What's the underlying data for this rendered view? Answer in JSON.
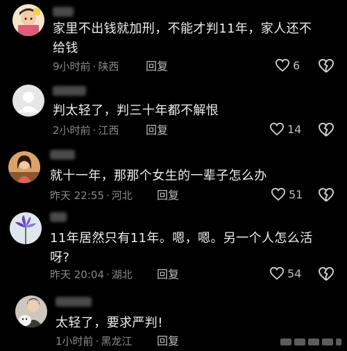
{
  "comments": [
    {
      "text_lines": [
        "家里不出钱就加刑，不能才判11年，家人还不",
        "给钱"
      ],
      "time": "9小时前",
      "location": "陕西",
      "reply_label": "回复",
      "likes": "6",
      "avatar_icon": "cartoon-child-avatar-icon"
    },
    {
      "text_lines": [
        "判太轻了，判三十年都不解恨"
      ],
      "time": "2小时前",
      "location": "江西",
      "reply_label": "回复",
      "likes": "14",
      "avatar_icon": "default-user-avatar-icon"
    },
    {
      "text_lines": [
        "就十一年，那那个女生的一辈子怎么办"
      ],
      "time": "昨天 22:55",
      "location": "河北",
      "reply_label": "回复",
      "likes": "51",
      "avatar_icon": "woman-photo-avatar-icon"
    },
    {
      "text_lines": [
        "11年居然只有11年。嗯，嗯。另一个人怎么活",
        "呀?"
      ],
      "time": "昨天 20:04",
      "location": "湖北",
      "reply_label": "回复",
      "likes": "54",
      "avatar_icon": "flower-avatar-icon"
    },
    {
      "text_lines": [
        "太轻了，要求严判!"
      ],
      "time": "1小时前",
      "location": "黑龙江",
      "reply_label": "回复",
      "likes": "",
      "avatar_icon": "person-with-dog-avatar-icon"
    }
  ],
  "colors": {
    "background": "#000000",
    "text": "#ededed",
    "meta": "#8a8a8a"
  }
}
